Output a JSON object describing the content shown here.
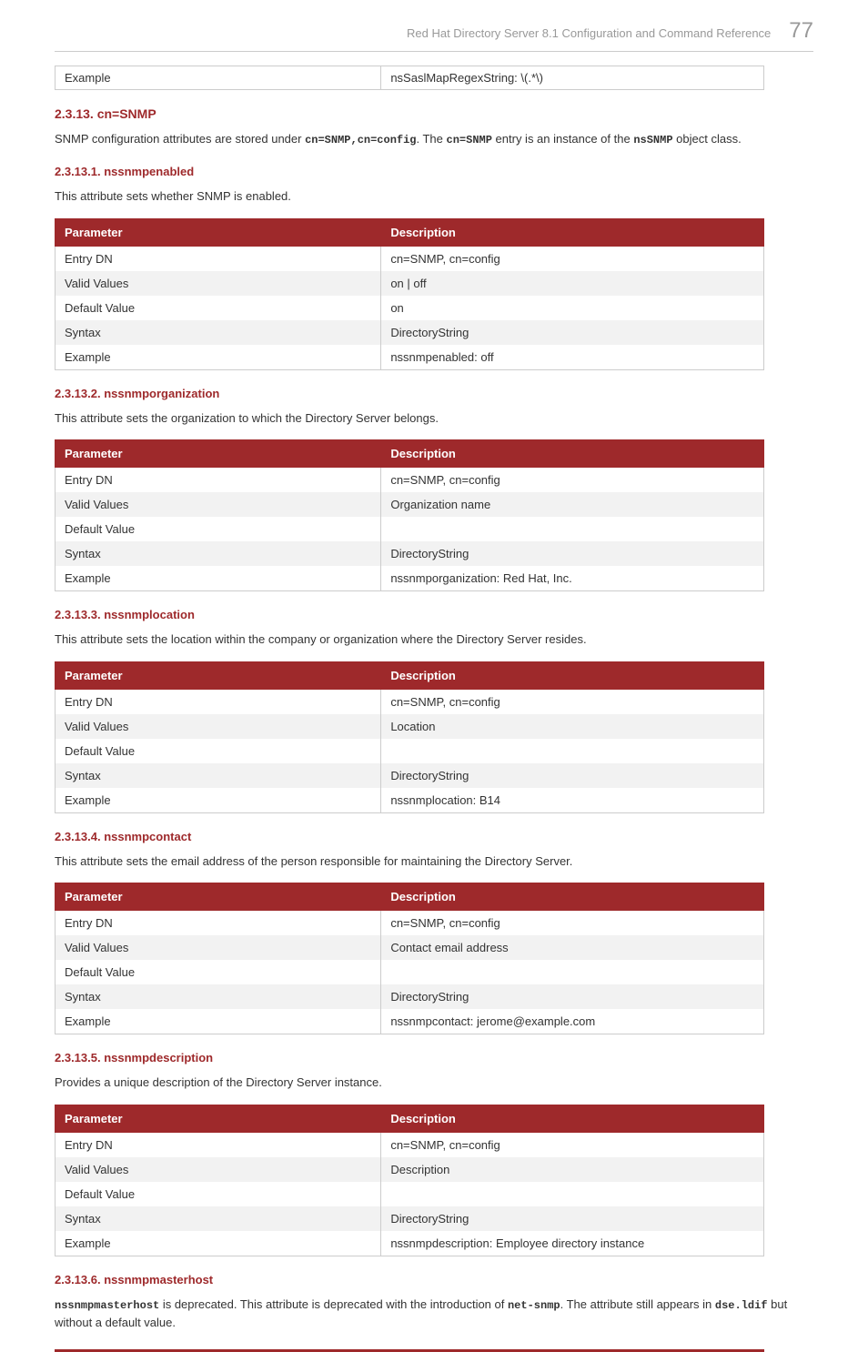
{
  "header": {
    "title": "Red Hat Directory Server 8.1 Configuration and Command Reference",
    "page": "77"
  },
  "top_table": {
    "label": "Example",
    "value": "nsSaslMapRegexString: \\(.*\\)"
  },
  "section_main": {
    "title": "2.3.13. cn=SNMP",
    "text_before": "SNMP configuration attributes are stored under ",
    "code1": "cn=SNMP,cn=config",
    "text_mid": ". The ",
    "code2": "cn=SNMP",
    "text_mid2": " entry is an instance of the ",
    "code3": "nsSNMP",
    "text_after": " object class."
  },
  "sections": [
    {
      "title": "2.3.13.1. nssnmpenabled",
      "intro": "This attribute sets whether SNMP is enabled.",
      "headers": {
        "param": "Parameter",
        "desc": "Description"
      },
      "rows": [
        {
          "p": "Entry DN",
          "d": "cn=SNMP, cn=config"
        },
        {
          "p": "Valid Values",
          "d": "on | off"
        },
        {
          "p": "Default Value",
          "d": "on"
        },
        {
          "p": "Syntax",
          "d": "DirectoryString"
        },
        {
          "p": "Example",
          "d": "nssnmpenabled: off"
        }
      ]
    },
    {
      "title": "2.3.13.2. nssnmporganization",
      "intro": "This attribute sets the organization to which the Directory Server belongs.",
      "headers": {
        "param": "Parameter",
        "desc": "Description"
      },
      "rows": [
        {
          "p": "Entry DN",
          "d": "cn=SNMP, cn=config"
        },
        {
          "p": "Valid Values",
          "d": "Organization name"
        },
        {
          "p": "Default Value",
          "d": ""
        },
        {
          "p": "Syntax",
          "d": "DirectoryString"
        },
        {
          "p": "Example",
          "d": "nssnmporganization: Red Hat, Inc."
        }
      ]
    },
    {
      "title": "2.3.13.3. nssnmplocation",
      "intro": "This attribute sets the location within the company or organization where the Directory Server resides.",
      "headers": {
        "param": "Parameter",
        "desc": "Description"
      },
      "rows": [
        {
          "p": "Entry DN",
          "d": "cn=SNMP, cn=config"
        },
        {
          "p": "Valid Values",
          "d": "Location"
        },
        {
          "p": "Default Value",
          "d": ""
        },
        {
          "p": "Syntax",
          "d": "DirectoryString"
        },
        {
          "p": "Example",
          "d": "nssnmplocation: B14"
        }
      ]
    },
    {
      "title": "2.3.13.4. nssnmpcontact",
      "intro": "This attribute sets the email address of the person responsible for maintaining the Directory Server.",
      "headers": {
        "param": "Parameter",
        "desc": "Description"
      },
      "rows": [
        {
          "p": "Entry DN",
          "d": "cn=SNMP, cn=config"
        },
        {
          "p": "Valid Values",
          "d": "Contact email address"
        },
        {
          "p": "Default Value",
          "d": ""
        },
        {
          "p": "Syntax",
          "d": "DirectoryString"
        },
        {
          "p": "Example",
          "d": "nssnmpcontact: jerome@example.com"
        }
      ]
    },
    {
      "title": "2.3.13.5. nssnmpdescription",
      "intro": "Provides a unique description of the Directory Server instance.",
      "headers": {
        "param": "Parameter",
        "desc": "Description"
      },
      "rows": [
        {
          "p": "Entry DN",
          "d": "cn=SNMP, cn=config"
        },
        {
          "p": "Valid Values",
          "d": "Description"
        },
        {
          "p": "Default Value",
          "d": ""
        },
        {
          "p": "Syntax",
          "d": "DirectoryString"
        },
        {
          "p": "Example",
          "d": "nssnmpdescription: Employee directory instance"
        }
      ]
    }
  ],
  "section_last": {
    "title": "2.3.13.6. nssnmpmasterhost",
    "code1": "nssnmpmasterhost",
    "text1": " is deprecated. This attribute is deprecated with the introduction of ",
    "code2": "net-snmp",
    "text2": ". The attribute still appears in ",
    "code3": "dse.ldif",
    "text3": " but without a default value."
  }
}
